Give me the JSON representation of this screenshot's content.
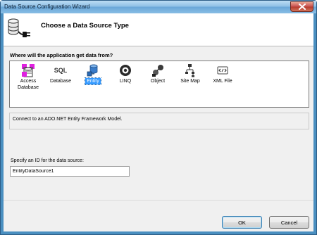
{
  "window": {
    "title": "Data Source Configuration Wizard"
  },
  "header": {
    "title": "Choose a Data Source Type"
  },
  "question": "Where will the application get data from?",
  "sources": [
    {
      "label": "Access Database",
      "icon": "access-database-icon"
    },
    {
      "label": "Database",
      "icon": "sql-database-icon"
    },
    {
      "label": "Entity",
      "icon": "entity-icon"
    },
    {
      "label": "LINQ",
      "icon": "linq-icon"
    },
    {
      "label": "Object",
      "icon": "object-icon"
    },
    {
      "label": "Site Map",
      "icon": "site-map-icon"
    },
    {
      "label": "XML File",
      "icon": "xml-file-icon"
    }
  ],
  "selected_source": "Entity",
  "description": "Connect to an ADO.NET Entity Framework Model.",
  "id_field": {
    "label": "Specify an ID for the data source:",
    "value": "EntityDataSource1"
  },
  "buttons": {
    "ok": "OK",
    "cancel": "Cancel"
  },
  "colors": {
    "selection": "#3399ff",
    "titlebar": "#88bde4",
    "body": "#f0f0f0"
  }
}
